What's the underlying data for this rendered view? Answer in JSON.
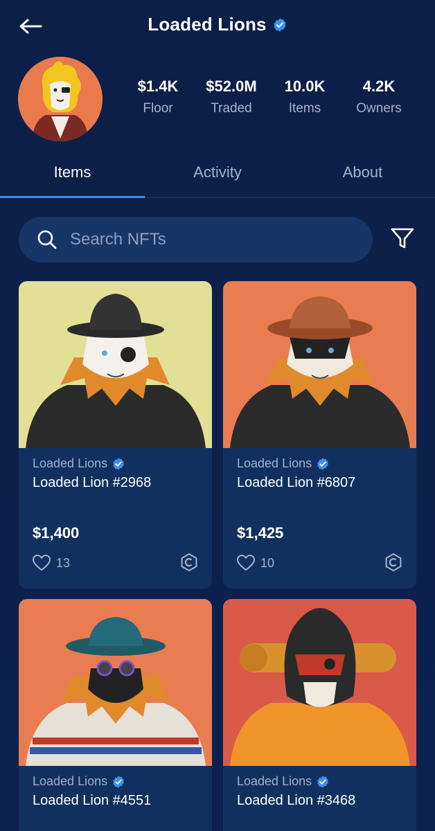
{
  "header": {
    "title": "Loaded Lions",
    "back_icon": "arrow-left-icon",
    "verified_icon": "verified-badge-icon"
  },
  "stats": [
    {
      "value": "$1.4K",
      "label": "Floor"
    },
    {
      "value": "$52.0M",
      "label": "Traded"
    },
    {
      "value": "10.0K",
      "label": "Items"
    },
    {
      "value": "4.2K",
      "label": "Owners"
    }
  ],
  "tabs": [
    {
      "label": "Items",
      "active": true
    },
    {
      "label": "Activity",
      "active": false
    },
    {
      "label": "About",
      "active": false
    }
  ],
  "search": {
    "placeholder": "Search NFTs",
    "value": "",
    "icon": "search-icon"
  },
  "filter": {
    "icon": "filter-icon"
  },
  "items": [
    {
      "collection": "Loaded Lions",
      "name": "Loaded Lion #2968",
      "price": "$1,400",
      "likes": "13",
      "bg": "#e2e097"
    },
    {
      "collection": "Loaded Lions",
      "name": "Loaded Lion #6807",
      "price": "$1,425",
      "likes": "10",
      "bg": "#ea7c52"
    },
    {
      "collection": "Loaded Lions",
      "name": "Loaded Lion #4551",
      "bg": "#ea7c52"
    },
    {
      "collection": "Loaded Lions",
      "name": "Loaded Lion #3468",
      "bg": "#d95a49"
    }
  ],
  "colors": {
    "background": "#0c1f47",
    "card": "#12305f",
    "accent": "#3d8ef2",
    "muted_text": "#a6b3cc"
  }
}
